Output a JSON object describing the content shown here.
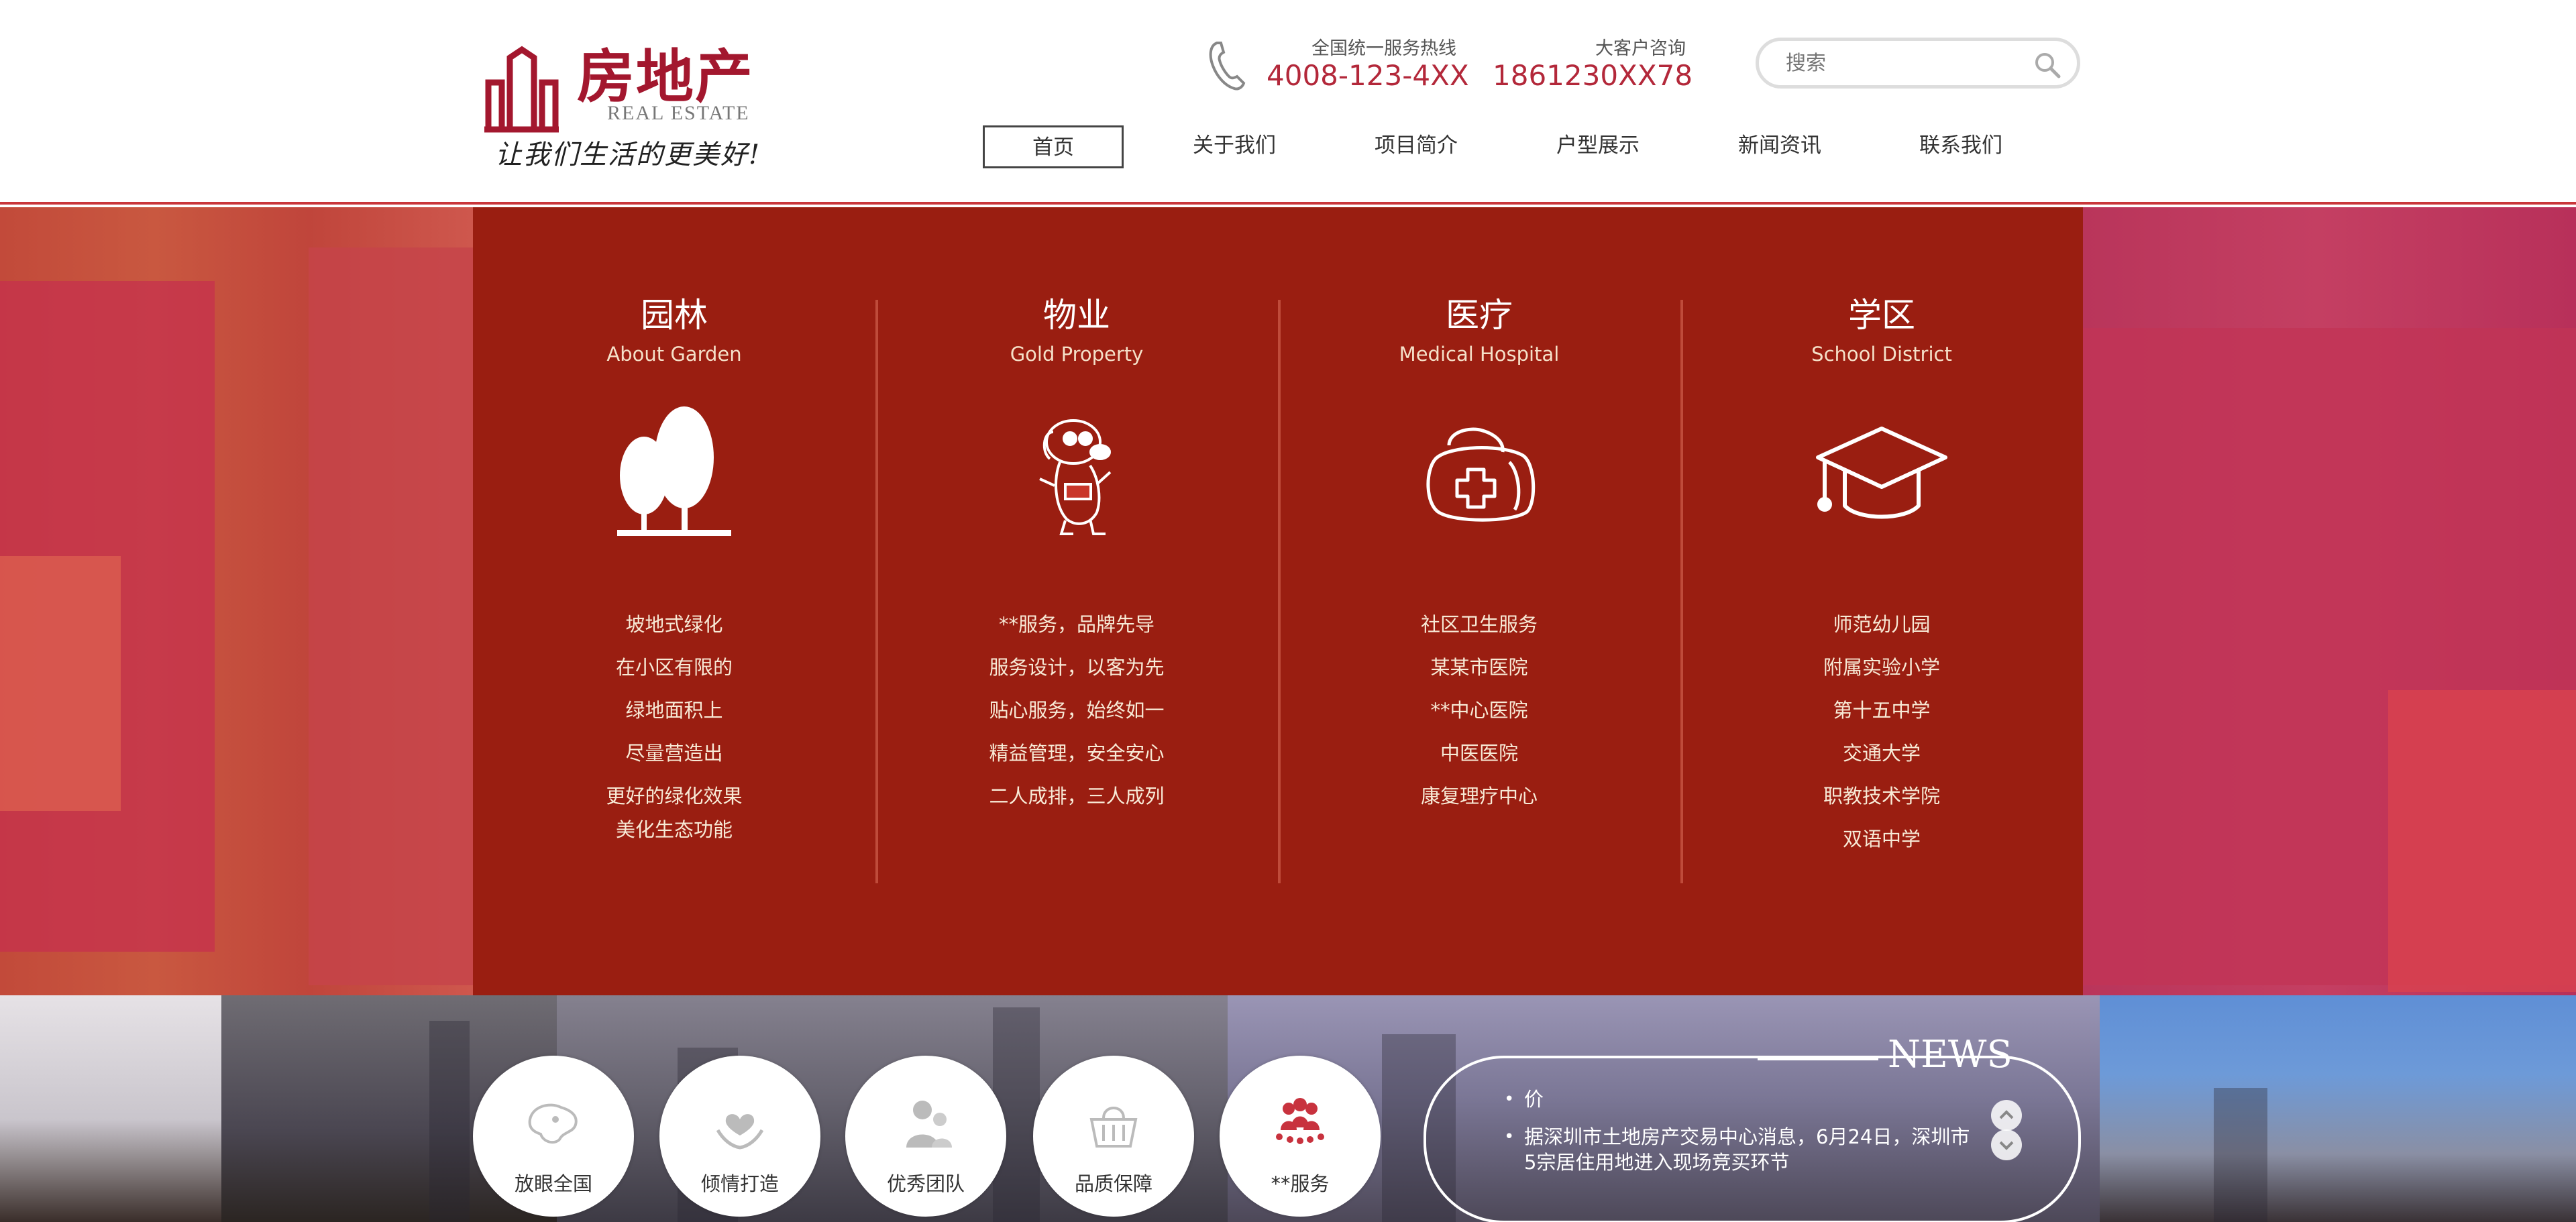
{
  "header": {
    "logo": {
      "title": "房地产",
      "subtitle": "REAL ESTATE",
      "slogan": "让我们生活的更美好!"
    },
    "hotline": {
      "label": "全国统一服务热线",
      "number": "4008-123-4XX",
      "icon": "phone-icon"
    },
    "consult": {
      "label": "大客户咨询",
      "number": "1861230XX78"
    },
    "search": {
      "placeholder": "搜索",
      "value": ""
    },
    "nav": [
      {
        "label": "首页",
        "active": true
      },
      {
        "label": "关于我们",
        "active": false
      },
      {
        "label": "项目简介",
        "active": false
      },
      {
        "label": "户型展示",
        "active": false
      },
      {
        "label": "新闻资讯",
        "active": false
      },
      {
        "label": "联系我们",
        "active": false
      }
    ]
  },
  "features": [
    {
      "title": "园林",
      "subtitle": "About Garden",
      "icon": "trees-icon",
      "lines": [
        "坡地式绿化",
        "在小区有限的",
        "绿地面积上",
        "尽量营造出",
        "更好的绿化效果",
        "美化生态功能"
      ]
    },
    {
      "title": "物业",
      "subtitle": "Gold Property",
      "icon": "mascot-icon",
      "lines": [
        "**服务，品牌先导",
        "服务设计，以客为先",
        "贴心服务，始终如一",
        "精益管理，安全安心",
        "二人成排，三人成列"
      ]
    },
    {
      "title": "医疗",
      "subtitle": "Medical Hospital",
      "icon": "medical-kit-icon",
      "lines": [
        "社区卫生服务",
        "某某市医院",
        "**中心医院",
        "中医医院",
        "康复理疗中心"
      ]
    },
    {
      "title": "学区",
      "subtitle": "School District",
      "icon": "graduation-cap-icon",
      "lines": [
        "师范幼儿园",
        "附属实验小学",
        "第十五中学",
        "交通大学",
        "职教技术学院",
        "双语中学"
      ]
    }
  ],
  "services": [
    {
      "label": "放眼全国",
      "icon": "map-icon"
    },
    {
      "label": "倾情打造",
      "icon": "heart-hands-icon"
    },
    {
      "label": "优秀团队",
      "icon": "team-icon"
    },
    {
      "label": "品质保障",
      "icon": "basket-icon"
    },
    {
      "label": "**服务",
      "icon": "people-group-icon"
    }
  ],
  "news": {
    "tag": "NEWS",
    "items": [
      "价",
      "据深圳市土地房产交易中心消息，6月24日，深圳市5宗居住用地进入现场竞买环节"
    ]
  },
  "colors": {
    "brand": "#a3172e",
    "accent": "#b3283a",
    "feature_bg": "#9a1e11"
  }
}
